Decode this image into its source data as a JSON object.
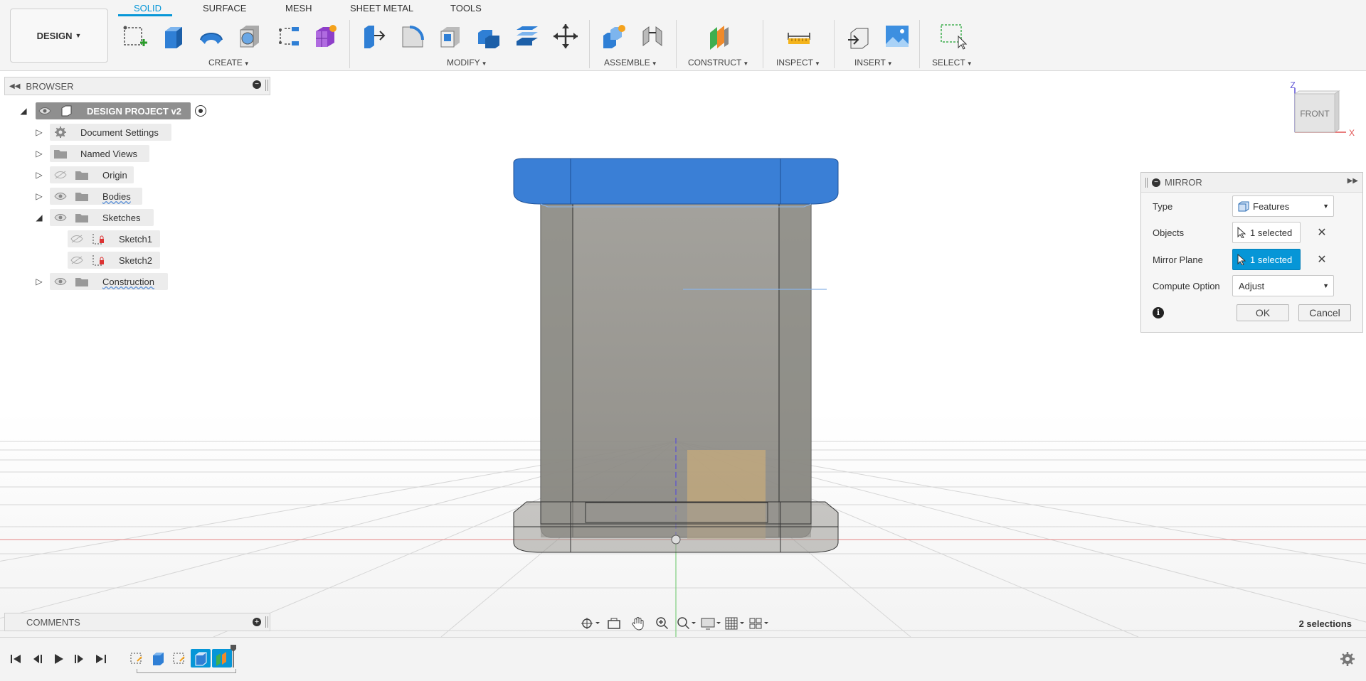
{
  "toolbar": {
    "workspace": "DESIGN",
    "tabs": [
      {
        "label": "SOLID",
        "active": true
      },
      {
        "label": "SURFACE",
        "active": false
      },
      {
        "label": "MESH",
        "active": false
      },
      {
        "label": "SHEET METAL",
        "active": false
      },
      {
        "label": "TOOLS",
        "active": false
      }
    ],
    "groups": {
      "create": "CREATE",
      "modify": "MODIFY",
      "assemble": "ASSEMBLE",
      "construct": "CONSTRUCT",
      "inspect": "INSPECT",
      "insert": "INSERT",
      "select": "SELECT"
    }
  },
  "browser": {
    "title": "BROWSER",
    "root": "DESIGN PROJECT v2",
    "items": [
      {
        "label": "Document Settings",
        "icon": "gear-icon"
      },
      {
        "label": "Named Views",
        "icon": "folder-icon"
      },
      {
        "label": "Origin",
        "icon": "folder-icon"
      },
      {
        "label": "Bodies",
        "icon": "folder-icon"
      },
      {
        "label": "Sketches",
        "icon": "folder-icon"
      },
      {
        "label": "Sketch1",
        "icon": "sketch-icon"
      },
      {
        "label": "Sketch2",
        "icon": "sketch-icon"
      },
      {
        "label": "Construction",
        "icon": "folder-icon"
      }
    ]
  },
  "viewcube": {
    "face": "FRONT",
    "axis_z": "Z",
    "axis_x": "X"
  },
  "mirror": {
    "title": "MIRROR",
    "type_label": "Type",
    "type_value": "Features",
    "objects_label": "Objects",
    "objects_value": "1 selected",
    "plane_label": "Mirror Plane",
    "plane_value": "1 selected",
    "compute_label": "Compute Option",
    "compute_value": "Adjust",
    "ok": "OK",
    "cancel": "Cancel"
  },
  "comments": {
    "title": "COMMENTS"
  },
  "status": {
    "selections": "2 selections"
  },
  "colors": {
    "accent": "#0696d7",
    "body_top": "#3a7fd6",
    "body_glass": "#8a8a84"
  }
}
